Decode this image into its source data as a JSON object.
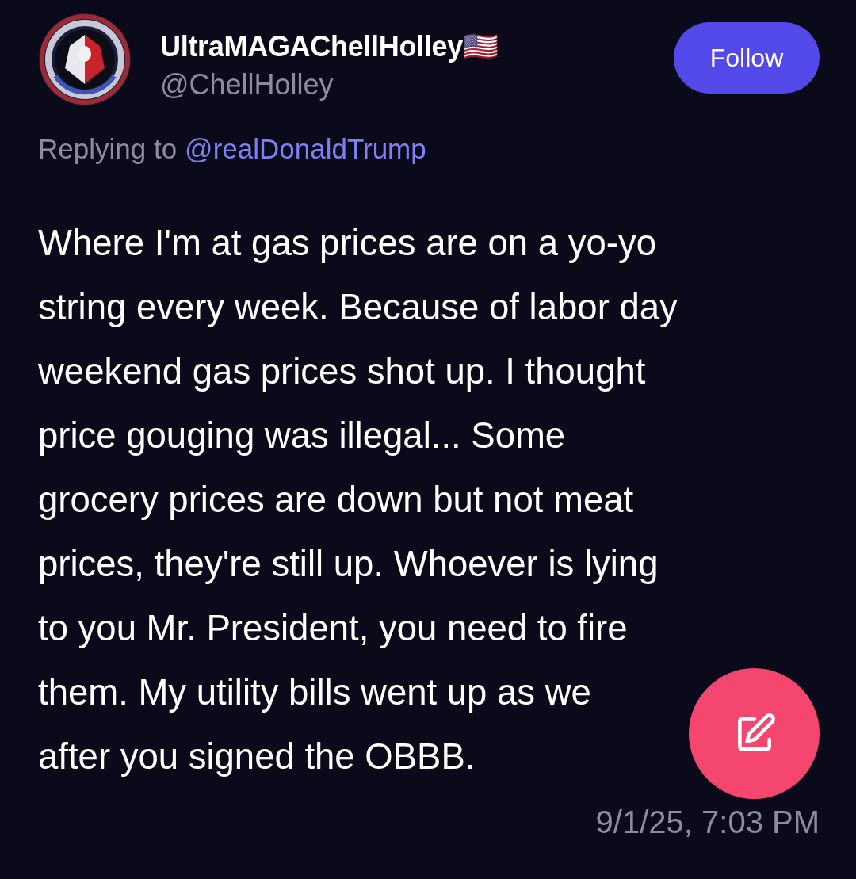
{
  "author": {
    "name": "UltraMAGAChellHolley🇺🇸",
    "handle": "@ChellHolley"
  },
  "follow_button": {
    "label": "Follow"
  },
  "reply_context": {
    "prefix": "Replying to",
    "mention": "@realDonaldTrump"
  },
  "body": "Where I'm at gas prices are on a yo-yo\nstring every week. Because of labor day\nweekend gas prices shot up. I thought\nprice gouging was illegal... Some\ngrocery prices are down but not meat\nprices, they're still up. Whoever is lying\nto you Mr. President, you need to fire\nthem. My utility bills went up as we\nafter you signed the OBBB.",
  "timestamp": "9/1/25, 7:03 PM",
  "compose_button": {
    "kind": "pencil"
  }
}
